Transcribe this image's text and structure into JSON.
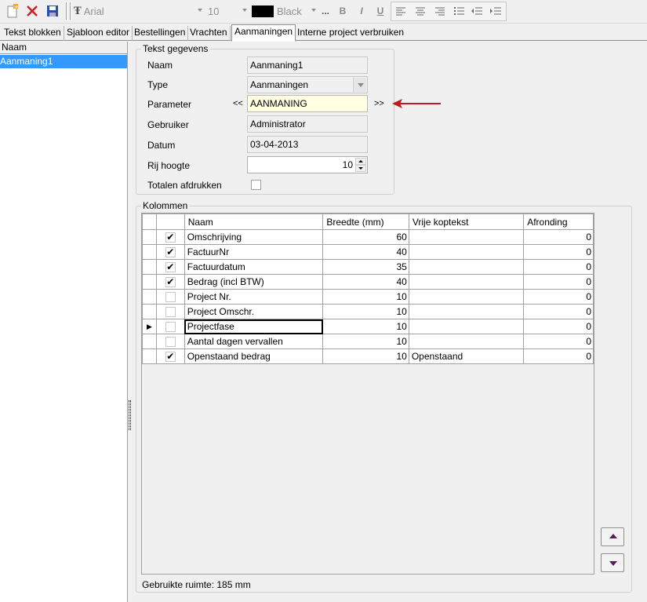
{
  "toolbar": {
    "font_name": "Arial",
    "font_size": "10",
    "color_name": "Black",
    "more_label": "...",
    "bold_label": "B",
    "italic_label": "I",
    "underline_label": "U",
    "accent_color": "#000000"
  },
  "tabs": [
    {
      "label": "Tekst blokken"
    },
    {
      "label": "Sjabloon editor"
    },
    {
      "label": "Bestellingen"
    },
    {
      "label": "Vrachten"
    },
    {
      "label": "Aanmaningen"
    },
    {
      "label": "Interne project verbruiken"
    }
  ],
  "left": {
    "header": "Naam",
    "items": [
      {
        "label": "Aanmaning1"
      }
    ]
  },
  "tekst": {
    "title": "Tekst gegevens",
    "naam_label": "Naam",
    "naam_value": "Aanmaning1",
    "type_label": "Type",
    "type_value": "Aanmaningen",
    "parameter_label": "Parameter",
    "parameter_prev": "<<",
    "parameter_value": "AANMANING",
    "parameter_next": ">>",
    "gebruiker_label": "Gebruiker",
    "gebruiker_value": "Administrator",
    "datum_label": "Datum",
    "datum_value": "03-04-2013",
    "rij_label": "Rij hoogte",
    "rij_value": "10",
    "totalen_label": "Totalen afdrukken"
  },
  "kolommen": {
    "title": "Kolommen",
    "headers": {
      "naam": "Naam",
      "breedte": "Breedte (mm)",
      "vrije": "Vrije koptekst",
      "afronding": "Afronding"
    },
    "rows": [
      {
        "checked": "✔",
        "naam": "Omschrijving",
        "breedte": "60",
        "vrije": "",
        "afronding": "0",
        "marker": ""
      },
      {
        "checked": "✔",
        "naam": "FactuurNr",
        "breedte": "40",
        "vrije": "",
        "afronding": "0",
        "marker": ""
      },
      {
        "checked": "✔",
        "naam": "Factuurdatum",
        "breedte": "35",
        "vrije": "",
        "afronding": "0",
        "marker": ""
      },
      {
        "checked": "✔",
        "naam": "Bedrag (incl BTW)",
        "breedte": "40",
        "vrije": "",
        "afronding": "0",
        "marker": ""
      },
      {
        "checked": "",
        "naam": "Project Nr.",
        "breedte": "10",
        "vrije": "",
        "afronding": "0",
        "marker": ""
      },
      {
        "checked": "",
        "naam": "Project Omschr.",
        "breedte": "10",
        "vrije": "",
        "afronding": "0",
        "marker": ""
      },
      {
        "checked": "",
        "naam": "Projectfase",
        "breedte": "10",
        "vrije": "",
        "afronding": "0",
        "marker": "▶"
      },
      {
        "checked": "",
        "naam": "Aantal dagen vervallen",
        "breedte": "10",
        "vrije": "",
        "afronding": "0",
        "marker": ""
      },
      {
        "checked": "✔",
        "naam": "Openstaand bedrag",
        "breedte": "10",
        "vrije": "Openstaand",
        "afronding": "0",
        "marker": ""
      }
    ],
    "footer": "Gebruikte ruimte: 185 mm"
  },
  "arrow_color": "#c0181e"
}
